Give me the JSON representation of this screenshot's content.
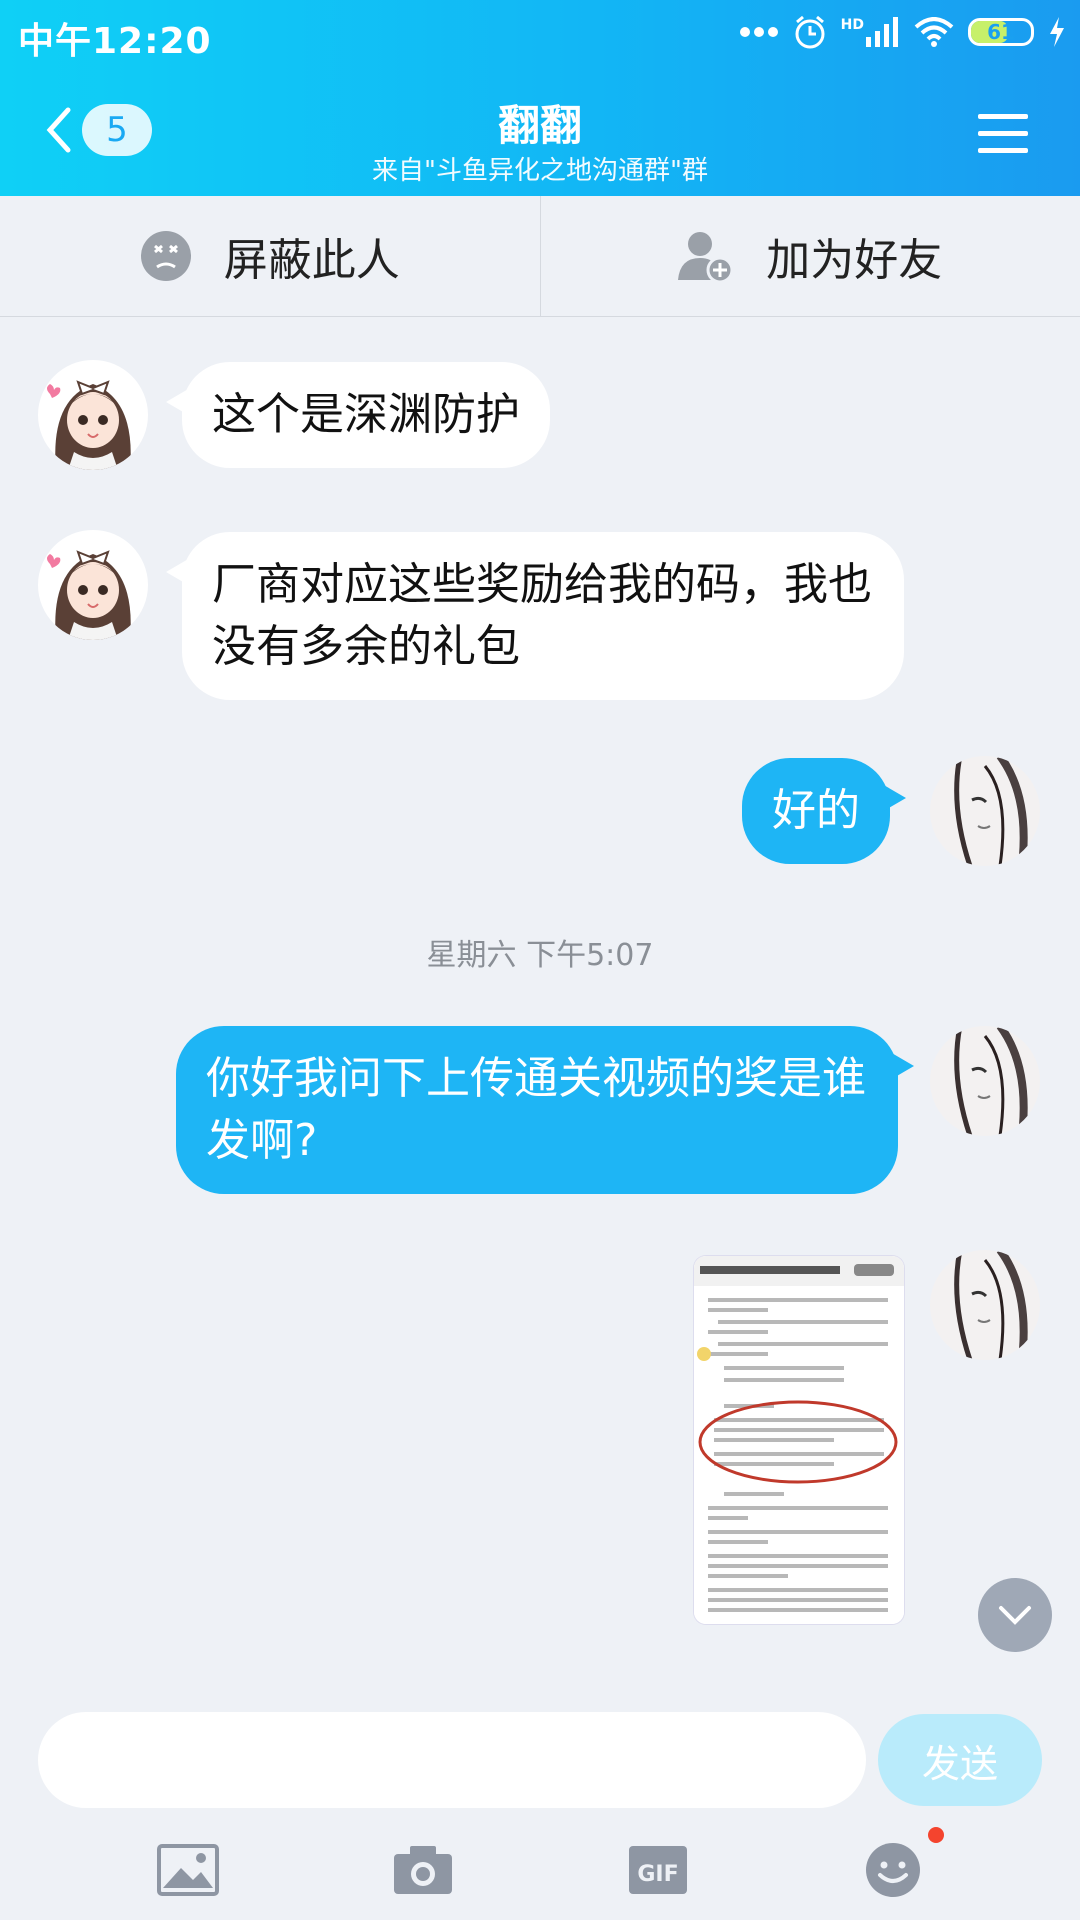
{
  "status_bar": {
    "time": "中午12:20",
    "network": "HD",
    "battery": "61"
  },
  "header": {
    "unread_count": "5",
    "title": "翻翻",
    "subtitle": "来自\"斗鱼异化之地沟通群\"群"
  },
  "actions": {
    "block_label": "屏蔽此人",
    "add_friend_label": "加为好友"
  },
  "messages": [
    {
      "side": "in",
      "text": "这个是深渊防护"
    },
    {
      "side": "in",
      "text": "厂商对应这些奖励给我的码，我也没有多余的礼包"
    },
    {
      "side": "out",
      "text": "好的"
    },
    {
      "side": "out",
      "text": "你好我问下上传通关视频的奖是谁发啊?"
    },
    {
      "side": "out",
      "type": "image"
    }
  ],
  "timestamp": "星期六 下午5:07",
  "composer": {
    "placeholder": "",
    "send_label": "发送"
  },
  "colors": {
    "header": "#12b6f5",
    "outgoing_bubble": "#1eb5f5",
    "incoming_bubble": "#ffffff",
    "background": "#eef1f6"
  }
}
